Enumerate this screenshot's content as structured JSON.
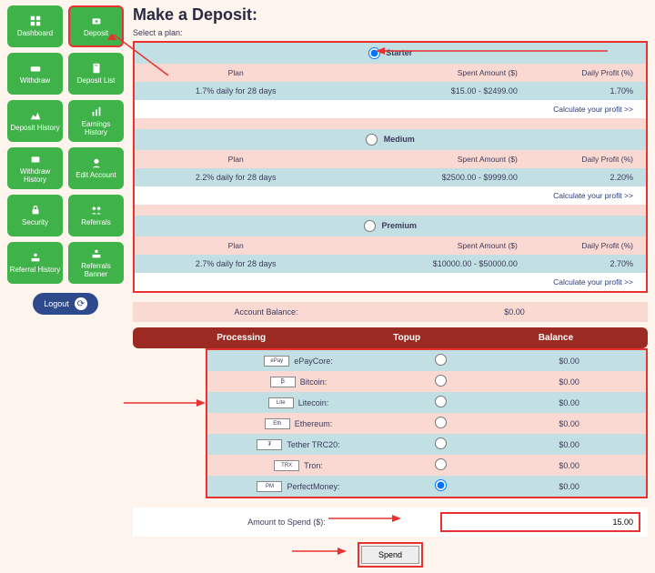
{
  "page": {
    "title": "Make a Deposit:",
    "selectPlan": "Select a plan:"
  },
  "sidebar": {
    "items": [
      {
        "label": "Dashboard",
        "icon": "dashboard"
      },
      {
        "label": "Deposit",
        "icon": "deposit"
      },
      {
        "label": "Withdraw",
        "icon": "withdraw"
      },
      {
        "label": "Deposit List",
        "icon": "list"
      },
      {
        "label": "Deposit History",
        "icon": "history"
      },
      {
        "label": "Earnings History",
        "icon": "earnings"
      },
      {
        "label": "Withdraw History",
        "icon": "whistory"
      },
      {
        "label": "Edit Account",
        "icon": "edit"
      },
      {
        "label": "Security",
        "icon": "security"
      },
      {
        "label": "Referrals",
        "icon": "referrals"
      },
      {
        "label": "Referral History",
        "icon": "refhist"
      },
      {
        "label": "Referrals Banner",
        "icon": "banner"
      }
    ],
    "logout": "Logout"
  },
  "headers": {
    "plan": "Plan",
    "spent": "Spent Amount ($)",
    "profit": "Daily Profit (%)",
    "calc": "Calculate your profit >>"
  },
  "plans": [
    {
      "name": "Starter",
      "desc": "1.7% daily for 28 days",
      "range": "$15.00 - $2499.00",
      "rate": "1.70%",
      "selected": true
    },
    {
      "name": "Medium",
      "desc": "2.2% daily for 28 days",
      "range": "$2500.00 - $9999.00",
      "rate": "2.20%",
      "selected": false
    },
    {
      "name": "Premium",
      "desc": "2.7% daily for 28 days",
      "range": "$10000.00 - $50000.00",
      "rate": "2.70%",
      "selected": false
    }
  ],
  "balance": {
    "label": "Account Balance:",
    "value": "$0.00"
  },
  "payHeaders": {
    "processing": "Processing",
    "topup": "Topup",
    "balance": "Balance"
  },
  "payments": [
    {
      "name": "ePayCore:",
      "bal": "$0.00",
      "sel": false,
      "ic": "ePay"
    },
    {
      "name": "Bitcoin:",
      "bal": "$0.00",
      "sel": false,
      "ic": "₿"
    },
    {
      "name": "Litecoin:",
      "bal": "$0.00",
      "sel": false,
      "ic": "Lite"
    },
    {
      "name": "Ethereum:",
      "bal": "$0.00",
      "sel": false,
      "ic": "Eth"
    },
    {
      "name": "Tether TRC20:",
      "bal": "$0.00",
      "sel": false,
      "ic": "₮"
    },
    {
      "name": "Tron:",
      "bal": "$0.00",
      "sel": false,
      "ic": "TRX"
    },
    {
      "name": "PerfectMoney:",
      "bal": "$0.00",
      "sel": true,
      "ic": "PM"
    }
  ],
  "amount": {
    "label": "Amount to Spend ($):",
    "value": "15.00"
  },
  "spend": "Spend"
}
